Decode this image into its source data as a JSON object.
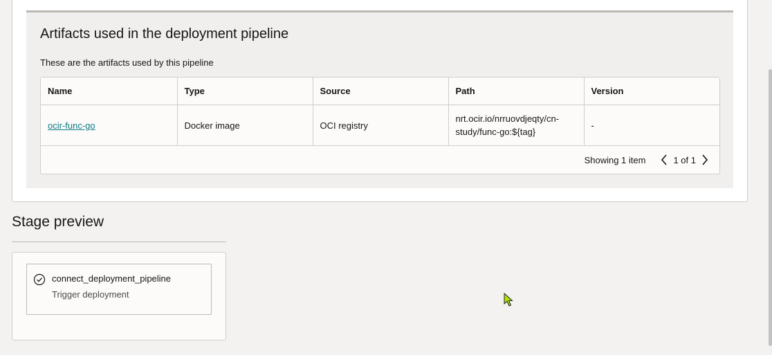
{
  "artifacts_panel": {
    "title": "Artifacts used in the deployment pipeline",
    "description": "These are the artifacts used by this pipeline",
    "columns": [
      "Name",
      "Type",
      "Source",
      "Path",
      "Version"
    ],
    "rows": [
      {
        "name": "ocir-func-go",
        "type": "Docker image",
        "source": "OCI registry",
        "path_line1": "nrt.ocir.io/nrruovdjeqty/cn-",
        "path_line2": "study/func-go:${tag}",
        "version": "-"
      }
    ],
    "pager": {
      "showing": "Showing 1 item",
      "pages": "1 of 1"
    }
  },
  "stage_preview": {
    "title": "Stage preview",
    "stage": {
      "name": "connect_deployment_pipeline",
      "type": "Trigger deployment",
      "icon": "check-circle-icon"
    }
  },
  "colors": {
    "link": "#0c7a83",
    "page_bg": "#f3f2f1",
    "panel_bg": "#f1efed",
    "cursor": "#aee00a"
  }
}
